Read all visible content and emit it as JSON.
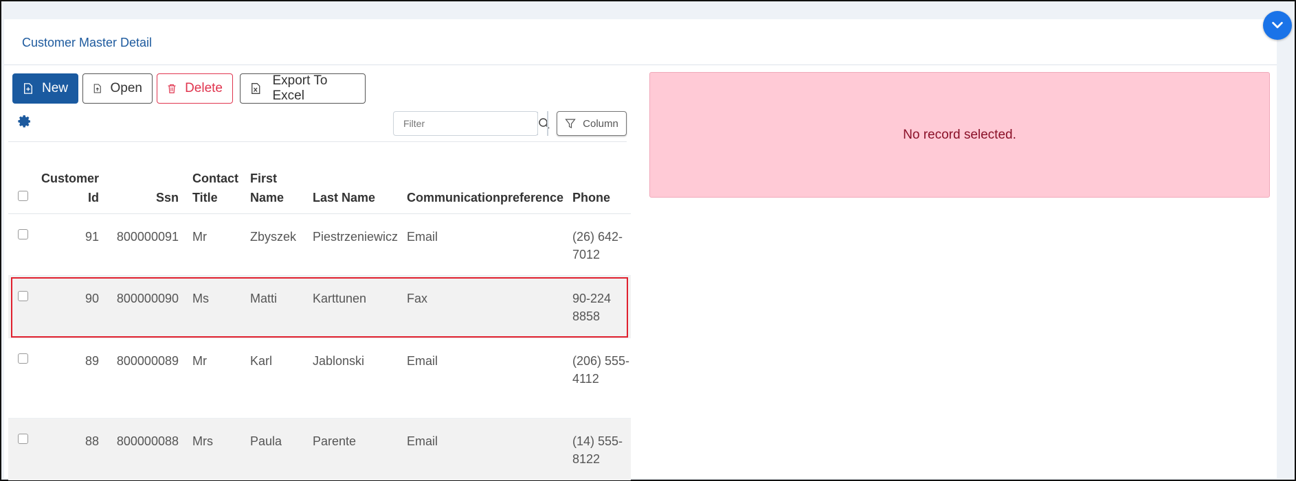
{
  "card": {
    "title": "Customer Master Detail"
  },
  "toolbar": {
    "new_label": "New",
    "open_label": "Open",
    "delete_label": "Delete",
    "export_label": "Export To Excel"
  },
  "filter": {
    "placeholder": "Filter"
  },
  "column_button": {
    "label": "Column"
  },
  "grid": {
    "headers": {
      "customer_id": [
        "Customer",
        "Id"
      ],
      "ssn": "Ssn",
      "contact_title": [
        "Contact",
        "Title"
      ],
      "first_name": [
        "First",
        "Name"
      ],
      "last_name": "Last Name",
      "communication": "Communicationpreference",
      "phone": "Phone"
    },
    "rows": [
      {
        "id": "91",
        "ssn": "800000091",
        "title": "Mr",
        "first": "Zbyszek",
        "last": "Piestrzeniewicz",
        "comm": "Email",
        "phone1": "(26) 642-",
        "phone2": "7012"
      },
      {
        "id": "90",
        "ssn": "800000090",
        "title": "Ms",
        "first": "Matti",
        "last": "Karttunen",
        "comm": "Fax",
        "phone1": "90-224",
        "phone2": "8858"
      },
      {
        "id": "89",
        "ssn": "800000089",
        "title": "Mr",
        "first": "Karl",
        "last": "Jablonski",
        "comm": "Email",
        "phone1": "(206) 555-",
        "phone2": "4112"
      },
      {
        "id": "88",
        "ssn": "800000088",
        "title": "Mrs",
        "first": "Paula",
        "last": "Parente",
        "comm": "Email",
        "phone1": "(14) 555-",
        "phone2": "8122"
      }
    ]
  },
  "detail": {
    "message": "No record selected."
  },
  "colors": {
    "primary": "#1a5aa0",
    "danger": "#e0344e",
    "detail_bg": "#ffcad6",
    "selection_outline": "#e0202e"
  },
  "icons": {
    "new": "file-plus-icon",
    "open": "file-upload-icon",
    "delete": "trash-icon",
    "export": "excel-file-icon",
    "settings": "gear-icon",
    "search": "search-icon",
    "column": "filter-funnel-icon",
    "collapse": "chevron-down-icon"
  }
}
